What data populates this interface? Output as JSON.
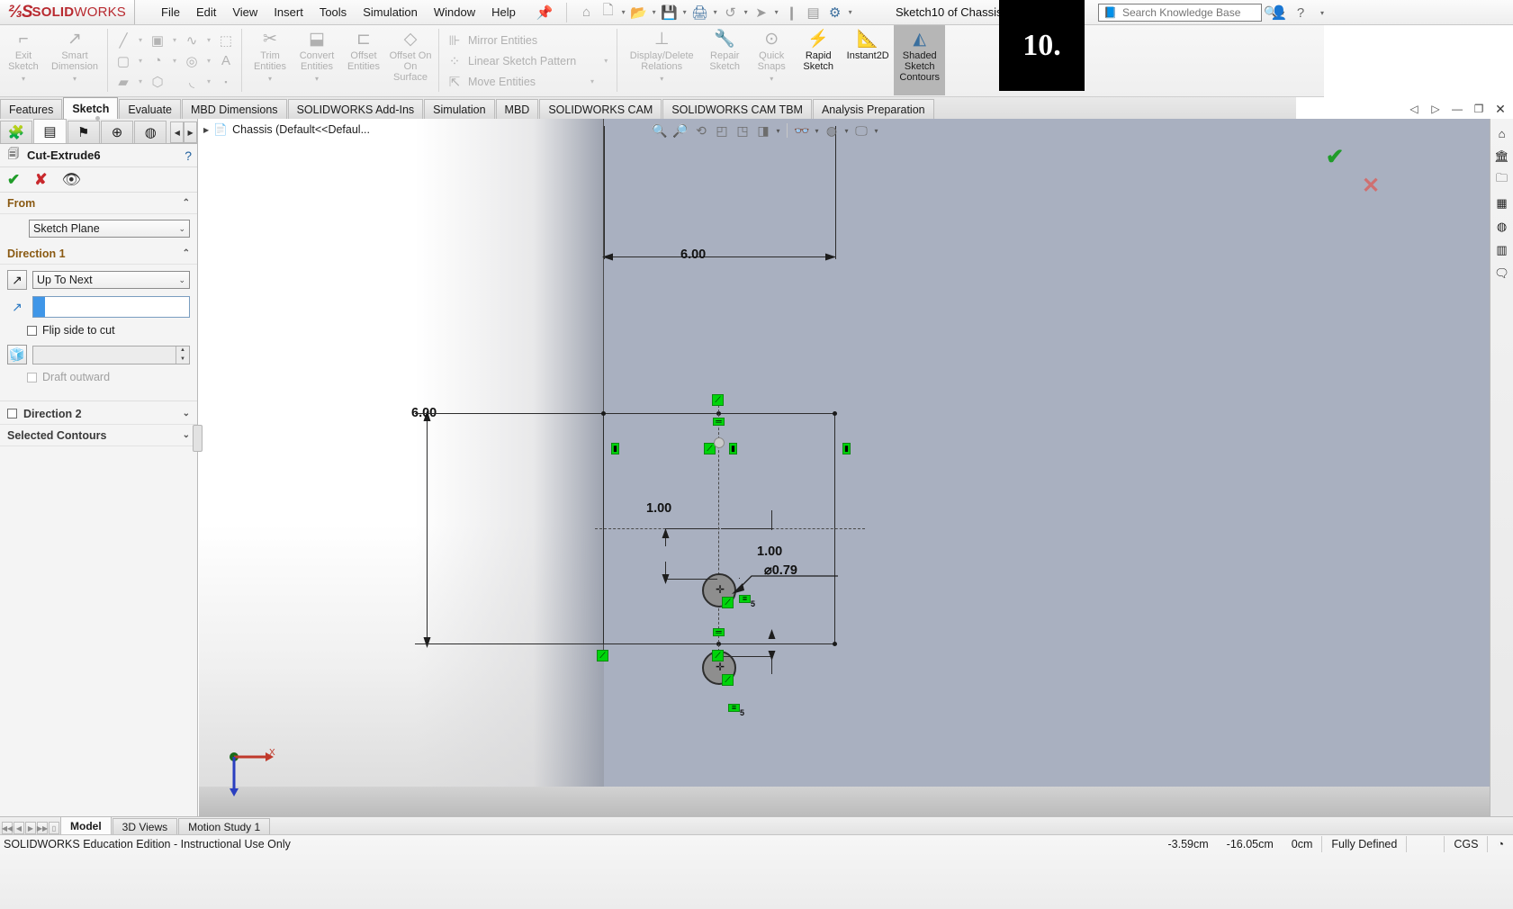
{
  "app": {
    "brand_ds": "2S",
    "brand_name": "SOLIDWORKS",
    "document_title": "Sketch10 of Chassis *",
    "accent_red": "#b8292f",
    "accent_blue": "#3f96e8",
    "relation_green": "#00d40b"
  },
  "menu": {
    "items": [
      {
        "label": "File"
      },
      {
        "label": "Edit"
      },
      {
        "label": "View"
      },
      {
        "label": "Insert"
      },
      {
        "label": "Tools"
      },
      {
        "label": "Simulation"
      },
      {
        "label": "Window"
      },
      {
        "label": "Help"
      }
    ],
    "pin_icon": "pin-icon"
  },
  "quick_access": [
    {
      "name": "home-icon",
      "glyph": "⌂",
      "caret": false,
      "active": false
    },
    {
      "name": "new-document-icon",
      "glyph": "🗋",
      "caret": true,
      "active": false
    },
    {
      "name": "open-folder-icon",
      "glyph": "📂",
      "caret": true,
      "active": false
    },
    {
      "name": "save-icon",
      "glyph": "💾",
      "caret": true,
      "active": false
    },
    {
      "name": "print-icon",
      "glyph": "🖨",
      "caret": true,
      "active": true
    },
    {
      "name": "undo-icon",
      "glyph": "↺",
      "caret": true,
      "active": false
    },
    {
      "name": "select-cursor-icon",
      "glyph": "➤",
      "caret": true,
      "active": false
    },
    {
      "name": "rebuild-icon",
      "glyph": "❙",
      "caret": false,
      "active": false
    },
    {
      "name": "options-list-icon",
      "glyph": "▤",
      "caret": false,
      "active": false
    },
    {
      "name": "settings-gear-icon",
      "glyph": "⚙",
      "caret": true,
      "active": true
    }
  ],
  "search": {
    "placeholder": "Search Knowledge Base",
    "value": "",
    "book_icon": "knowledge-book-icon",
    "mag_icon": "search-icon"
  },
  "title_right_buttons": [
    {
      "name": "user-account-icon",
      "glyph": "👤"
    },
    {
      "name": "help-question-icon",
      "glyph": "?"
    },
    {
      "name": "help-dropdown-caret-icon",
      "glyph": "▾"
    }
  ],
  "overlay_badge": {
    "text": "10."
  },
  "ribbon": {
    "groups": [
      {
        "type": "big",
        "buttons": [
          {
            "label": "Exit\nSketch",
            "line1": "Exit",
            "line2": "Sketch",
            "icon": "exit-sketch-icon",
            "glyph": "⌐",
            "enabled": false,
            "caret": true,
            "selected": false
          },
          {
            "label": "Smart Dimension",
            "line1": "Smart",
            "line2": "Dimension",
            "icon": "smart-dimension-icon",
            "glyph": "↗",
            "enabled": false,
            "caret": true,
            "selected": false
          }
        ]
      },
      {
        "type": "grid",
        "rows": [
          [
            {
              "icon": "line-tool-icon",
              "glyph": "╱",
              "caret": true
            },
            {
              "icon": "rectangle-corner-icon",
              "glyph": "▭",
              "caret": true
            },
            {
              "icon": "spline-icon",
              "glyph": "∿",
              "caret": true
            },
            {
              "icon": "trim-area-icon",
              "glyph": "⬚",
              "caret": false
            }
          ],
          [
            {
              "icon": "center-rectangle-icon",
              "glyph": "▢",
              "caret": true
            },
            {
              "icon": "arc-icon",
              "glyph": "◔",
              "caret": true
            },
            {
              "icon": "circle-icon",
              "glyph": "◎",
              "caret": true
            },
            {
              "icon": "text-tool-icon",
              "glyph": "A",
              "caret": false
            }
          ],
          [
            {
              "icon": "slot-icon",
              "glyph": "▰",
              "caret": true
            },
            {
              "icon": "polygon-icon",
              "glyph": "⬡",
              "caret": false
            },
            {
              "icon": "fillet-icon",
              "glyph": "◟",
              "caret": true
            },
            {
              "icon": "point-icon",
              "glyph": "▪",
              "caret": false
            }
          ]
        ]
      },
      {
        "type": "big",
        "buttons": [
          {
            "line1": "Trim",
            "line2": "Entities",
            "icon": "trim-entities-icon",
            "glyph": "✂",
            "enabled": false,
            "caret": true
          },
          {
            "line1": "Convert",
            "line2": "Entities",
            "icon": "convert-entities-icon",
            "glyph": "⬓",
            "enabled": false,
            "caret": true
          },
          {
            "line1": "Offset",
            "line2": "Entities",
            "icon": "offset-entities-icon",
            "glyph": "⊏",
            "enabled": false,
            "caret": false
          },
          {
            "line1": "Offset On",
            "line2": "Surface",
            "line3": "Surface",
            "icon": "offset-on-surface-icon",
            "glyph": "◇",
            "enabled": false,
            "caret": false
          }
        ]
      },
      {
        "type": "rows-labeled",
        "rows": [
          {
            "icon": "mirror-entities-icon",
            "glyph": "⊪",
            "label": "Mirror Entities",
            "caret": false
          },
          {
            "icon": "linear-sketch-pattern-icon",
            "glyph": "⁙",
            "label": "Linear Sketch Pattern",
            "caret": true
          },
          {
            "icon": "move-entities-icon",
            "glyph": "⇱",
            "label": "Move Entities",
            "caret": true
          }
        ]
      },
      {
        "type": "big",
        "buttons": [
          {
            "line1": "Display/Delete",
            "line2": "Relations",
            "icon": "display-delete-relations-icon",
            "glyph": "⊥",
            "enabled": false,
            "caret": true,
            "wide": true
          },
          {
            "line1": "Repair",
            "line2": "Sketch",
            "icon": "repair-sketch-icon",
            "glyph": "🔧",
            "enabled": false,
            "caret": false
          },
          {
            "line1": "Quick",
            "line2": "Snaps",
            "icon": "quick-snaps-icon",
            "glyph": "⊙",
            "enabled": false,
            "caret": true
          },
          {
            "line1": "Rapid",
            "line2": "Sketch",
            "icon": "rapid-sketch-icon",
            "glyph": "⚡",
            "enabled": true,
            "caret": false
          },
          {
            "line1": "Instant2D",
            "line2": "",
            "icon": "instant2d-icon",
            "glyph": "📐",
            "enabled": true,
            "caret": false,
            "wide": true
          },
          {
            "line1": "Shaded",
            "line2": "Sketch",
            "line3": "Contours",
            "icon": "shaded-sketch-contours-icon",
            "glyph": "◭",
            "enabled": true,
            "caret": false,
            "selected": true
          }
        ]
      }
    ]
  },
  "command_tabs": [
    {
      "label": "Features",
      "active": false
    },
    {
      "label": "Sketch",
      "active": true
    },
    {
      "label": "Evaluate",
      "active": false
    },
    {
      "label": "MBD Dimensions",
      "active": false
    },
    {
      "label": "SOLIDWORKS Add-Ins",
      "active": false
    },
    {
      "label": "Simulation",
      "active": false
    },
    {
      "label": "MBD",
      "active": false
    },
    {
      "label": "SOLIDWORKS CAM",
      "active": false
    },
    {
      "label": "SOLIDWORKS CAM TBM",
      "active": false
    },
    {
      "label": "Analysis Preparation",
      "active": false
    }
  ],
  "window_controls": [
    {
      "name": "pin-left-icon",
      "glyph": "◁"
    },
    {
      "name": "pin-right-icon",
      "glyph": "▷"
    },
    {
      "name": "minimize-window-button",
      "glyph": "—"
    },
    {
      "name": "restore-window-button",
      "glyph": "❐"
    },
    {
      "name": "close-window-button",
      "glyph": "✕"
    }
  ],
  "property_manager": {
    "tabs": [
      {
        "name": "feature-manager-tab",
        "glyph": "🧩",
        "active": false
      },
      {
        "name": "property-manager-tab",
        "glyph": "▤",
        "active": true
      },
      {
        "name": "configuration-manager-tab",
        "glyph": "⚑",
        "active": false
      },
      {
        "name": "dimxpert-manager-tab",
        "glyph": "⊕",
        "active": false
      },
      {
        "name": "display-manager-tab",
        "glyph": "◉",
        "active": false
      }
    ],
    "feature_name": "Cut-Extrude6",
    "feature_icon": "cut-extrude-icon",
    "help_icon": "help-circle-icon",
    "actions": [
      {
        "name": "accept-ok-button",
        "glyph": "✔"
      },
      {
        "name": "cancel-button",
        "glyph": "✘"
      },
      {
        "name": "detailed-preview-eye-button",
        "glyph": "👁"
      }
    ],
    "sections": [
      {
        "title": "From",
        "collapsed": false,
        "start_condition": "Sketch Plane"
      },
      {
        "title": "Direction 1",
        "collapsed": false,
        "end_condition": "Up To Next",
        "reverse_direction_icon": "reverse-direction-icon",
        "face_selection_value": "",
        "flip_side_label": "Flip side to cut",
        "flip_side_checked": false,
        "draft_value": "",
        "draft_label": "Draft outward",
        "draft_checked": false
      },
      {
        "title": "Direction 2",
        "collapsed": true,
        "checkbox": true
      },
      {
        "title": "Selected Contours",
        "collapsed": true,
        "checkbox": false
      }
    ]
  },
  "feature_tree": {
    "root_label": "Chassis  (Default<<Defaul...",
    "expand_glyph": "▶",
    "icon": "part-document-icon"
  },
  "heads_up_toolbar": [
    {
      "name": "zoom-to-fit-icon",
      "glyph": "🔍",
      "caret": false
    },
    {
      "name": "zoom-to-area-icon",
      "glyph": "🔎",
      "caret": false
    },
    {
      "name": "previous-view-icon",
      "glyph": "⟲",
      "caret": false
    },
    {
      "name": "section-view-icon",
      "glyph": "◰",
      "caret": false
    },
    {
      "name": "view-orientation-icon",
      "glyph": "◳",
      "caret": false
    },
    {
      "name": "display-style-icon",
      "glyph": "◨",
      "caret": true
    },
    {
      "name": "hide-show-items-icon",
      "glyph": "👓",
      "caret": true
    },
    {
      "name": "appearances-icon",
      "glyph": "◍",
      "caret": true
    },
    {
      "name": "apply-scene-icon",
      "glyph": "🖵",
      "caret": true
    }
  ],
  "sketch_dimensions": {
    "width": "6.00",
    "height": "6.00",
    "hole_diameter": "⌀0.79",
    "top_hole_offset": "1.00",
    "bottom_hole_offset": "1.00"
  },
  "relations": [
    {
      "name": "coincident-relation",
      "glyph": "▰"
    },
    {
      "name": "horizontal-relation",
      "glyph": "▰"
    },
    {
      "name": "vertical-relation",
      "glyph": "▮"
    },
    {
      "name": "symmetric-relation",
      "glyph": "⋈"
    },
    {
      "name": "equal-relation",
      "glyph": "≡",
      "sub": "5"
    },
    {
      "name": "concentric-relation",
      "glyph": "◎"
    }
  ],
  "task_pane": [
    {
      "name": "solidworks-resources-icon",
      "glyph": "⌂"
    },
    {
      "name": "design-library-icon",
      "glyph": "🏛"
    },
    {
      "name": "file-explorer-icon",
      "glyph": "🗀"
    },
    {
      "name": "view-palette-icon",
      "glyph": "▦"
    },
    {
      "name": "appearances-scenes-icon",
      "glyph": "◍"
    },
    {
      "name": "custom-properties-icon",
      "glyph": "▥"
    },
    {
      "name": "solidworks-forum-icon",
      "glyph": "🗨"
    }
  ],
  "triad": {
    "x_label": "X",
    "y_label": ""
  },
  "bottom_tabs": [
    {
      "label": "Model",
      "active": true
    },
    {
      "label": "3D Views",
      "active": false
    },
    {
      "label": "Motion Study 1",
      "active": false
    }
  ],
  "status_bar": {
    "message": "SOLIDWORKS Education Edition - Instructional Use Only",
    "coord_x": "-3.59cm",
    "coord_y": "-16.05cm",
    "coord_z": "0cm",
    "sketch_state": "Fully Defined",
    "units": "CGS",
    "editing_icon": "editing-part-icon"
  }
}
